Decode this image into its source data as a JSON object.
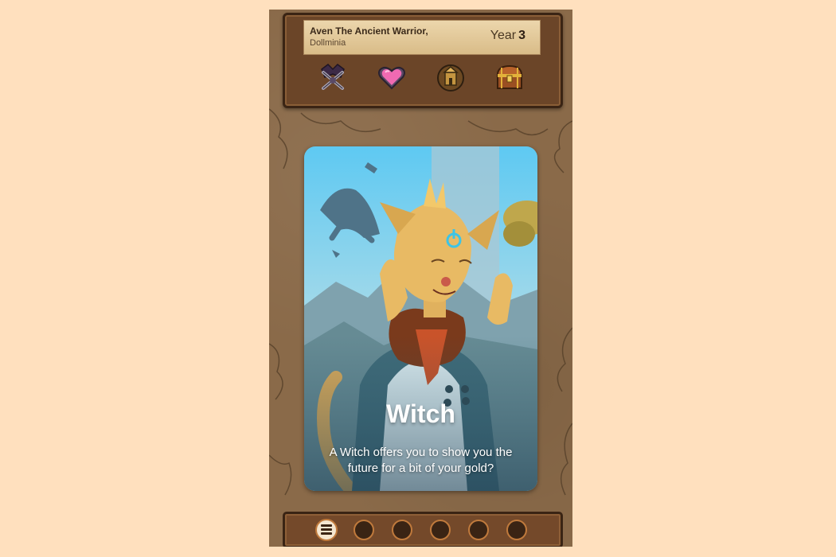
{
  "hero": {
    "name": "Aven The Ancient Warrior,",
    "realm": "Dollminia",
    "year_label": "Year",
    "year_value": "3"
  },
  "stats": [
    {
      "name": "army-icon"
    },
    {
      "name": "heart-icon"
    },
    {
      "name": "church-icon"
    },
    {
      "name": "treasure-chest-icon"
    }
  ],
  "card": {
    "title": "Witch",
    "description": "A Witch offers you to show you the future for a bit of your gold?"
  },
  "bottom_bar": {
    "menu_icon": "menu-icon",
    "slot_count": 5
  },
  "colors": {
    "background": "#FFE0BE",
    "wood": "#6B4528",
    "parchment": "#E2C89A",
    "slot_ring": "#C07A3C"
  }
}
